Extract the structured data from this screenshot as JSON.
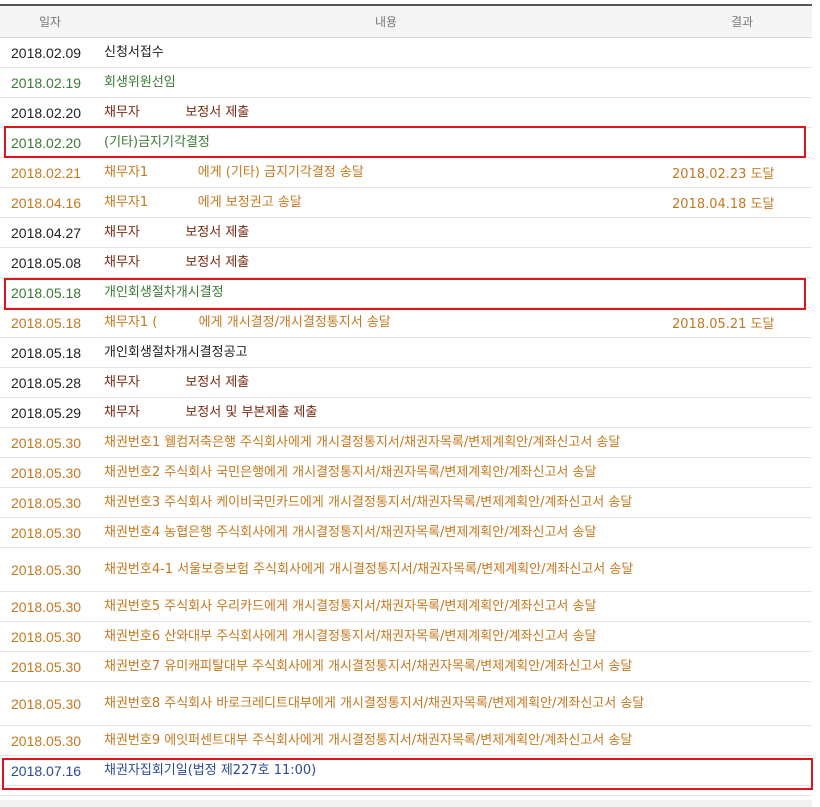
{
  "header": {
    "date": "일자",
    "content": "내용",
    "result": "결과"
  },
  "rows": [
    {
      "date": "2018.02.09",
      "content": "신청서접수",
      "result": ""
    },
    {
      "date": "2018.02.19",
      "content": "회생위원선임",
      "result": ""
    },
    {
      "date": "2018.02.20",
      "content": "채무자           보정서 제출",
      "result": ""
    },
    {
      "date": "2018.02.20",
      "content": "(기타)금지기각결정",
      "result": ""
    },
    {
      "date": "2018.02.21",
      "content": "채무자1            에게 (기타) 금지기각결정 송달",
      "result": "2018.02.23 도달"
    },
    {
      "date": "2018.04.16",
      "content": "채무자1            에게 보정권고 송달",
      "result": "2018.04.18 도달"
    },
    {
      "date": "2018.04.27",
      "content": "채무자           보정서 제출",
      "result": ""
    },
    {
      "date": "2018.05.08",
      "content": "채무자           보정서 제출",
      "result": ""
    },
    {
      "date": "2018.05.18",
      "content": "개인회생절차개시결정",
      "result": ""
    },
    {
      "date": "2018.05.18",
      "content": "채무자1 (          에게 개시결정/개시결정통지서 송달",
      "result": "2018.05.21 도달"
    },
    {
      "date": "2018.05.18",
      "content": "개인회생절차개시결정공고",
      "result": ""
    },
    {
      "date": "2018.05.28",
      "content": "채무자           보정서 제출",
      "result": ""
    },
    {
      "date": "2018.05.29",
      "content": "채무자           보정서 및 부본제출 제출",
      "result": ""
    },
    {
      "date": "2018.05.30",
      "content": "채권번호1 웰컴저축은행 주식회사에게 개시결정통지서/채권자목록/변제계획안/계좌신고서 송달",
      "result": ""
    },
    {
      "date": "2018.05.30",
      "content": "채권번호2 주식회사 국민은행에게 개시결정통지서/채권자목록/변제계획안/계좌신고서 송달",
      "result": ""
    },
    {
      "date": "2018.05.30",
      "content": "채권번호3 주식회사 케이비국민카드에게 개시결정통지서/채권자목록/변제계획안/계좌신고서 송달",
      "result": ""
    },
    {
      "date": "2018.05.30",
      "content": "채권번호4 농협은행 주식회사에게 개시결정통지서/채권자목록/변제계획안/계좌신고서 송달",
      "result": ""
    },
    {
      "date": "2018.05.30",
      "content": "채권번호4-1 서울보증보험 주식회사에게 개시결정통지서/채권자목록/변제계획안/계좌신고서 송달",
      "result": ""
    },
    {
      "date": "2018.05.30",
      "content": "채권번호5 주식회사 우리카드에게 개시결정통지서/채권자목록/변제계획안/계좌신고서 송달",
      "result": ""
    },
    {
      "date": "2018.05.30",
      "content": "채권번호6 산와대부 주식회사에게 개시결정통지서/채권자목록/변제계획안/계좌신고서 송달",
      "result": ""
    },
    {
      "date": "2018.05.30",
      "content": "채권번호7 유미캐피탈대부 주식회사에게 개시결정통지서/채권자목록/변제계획안/계좌신고서 송달",
      "result": ""
    },
    {
      "date": "2018.05.30",
      "content": "채권번호8 주식회사 바로크레디트대부에게 개시결정통지서/채권자목록/변제계획안/계좌신고서 송달",
      "result": ""
    },
    {
      "date": "2018.05.30",
      "content": "채권번호9 에잇퍼센트대부 주식회사에게 개시결정통지서/채권자목록/변제계획안/계좌신고서 송달",
      "result": ""
    },
    {
      "date": "2018.07.16",
      "content": "채권자집회기일(법정 제227호 11:00)",
      "result": ""
    }
  ],
  "colors": {
    "highlight": "#e0141b",
    "black": "#222222",
    "green": "#3b7a35",
    "brown": "#7a2a12",
    "orange": "#c7781f",
    "blue": "#2b4a9a"
  }
}
